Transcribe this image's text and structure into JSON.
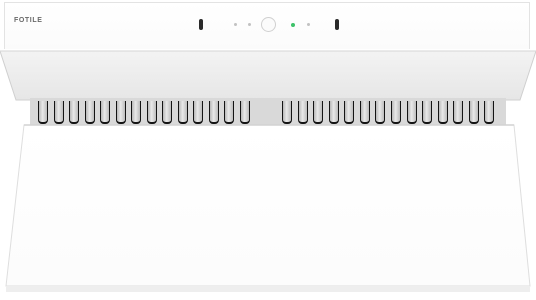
{
  "product": {
    "brand_logo": "FOTILE",
    "panel_color": "#ffffff",
    "indicator_color": "#3ec26a"
  },
  "controls": {
    "icons": [
      "slot-icon",
      "touch-dot-icon",
      "touch-dot-icon",
      "dial-icon",
      "power-led-icon",
      "touch-dot-icon",
      "slot-icon"
    ]
  }
}
